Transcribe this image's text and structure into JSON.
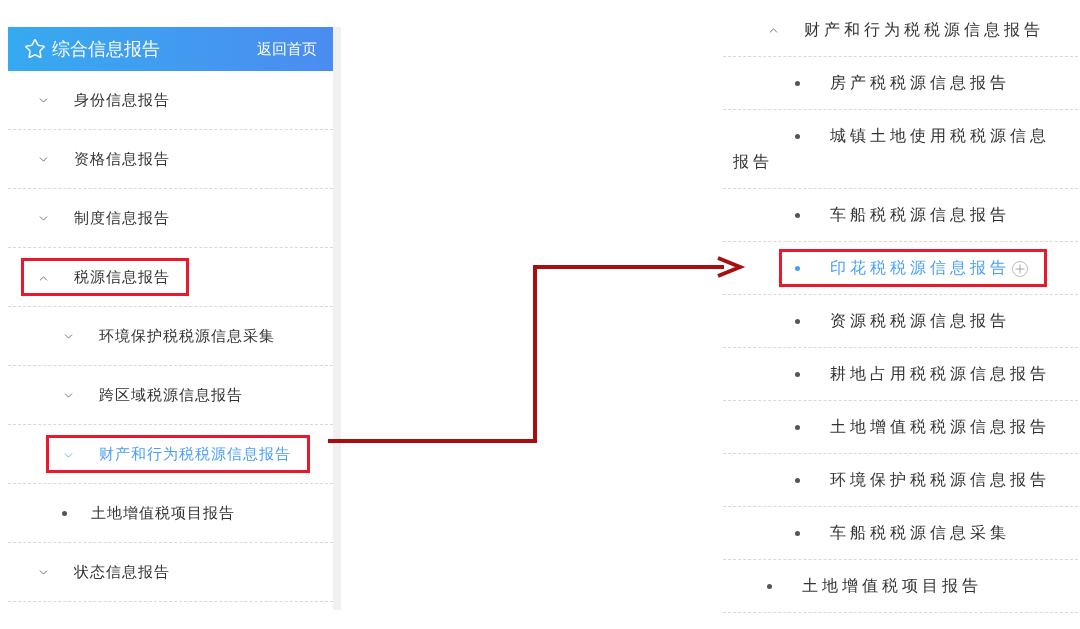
{
  "left_panel": {
    "header": {
      "title": "综合信息报告",
      "home_link": "返回首页"
    },
    "items": [
      {
        "label": "身份信息报告",
        "kind": "group",
        "expanded": false,
        "selected": false,
        "highlighted": false
      },
      {
        "label": "资格信息报告",
        "kind": "group",
        "expanded": false,
        "selected": false,
        "highlighted": false
      },
      {
        "label": "制度信息报告",
        "kind": "group",
        "expanded": false,
        "selected": false,
        "highlighted": false
      },
      {
        "label": "税源信息报告",
        "kind": "group",
        "expanded": true,
        "selected": false,
        "highlighted": true,
        "children": [
          {
            "label": "环境保护税税源信息采集",
            "kind": "group",
            "expanded": false,
            "selected": false,
            "highlighted": false
          },
          {
            "label": "跨区域税源信息报告",
            "kind": "group",
            "expanded": false,
            "selected": false,
            "highlighted": false
          },
          {
            "label": "财产和行为税税源信息报告",
            "kind": "group",
            "expanded": false,
            "selected": true,
            "highlighted": true
          },
          {
            "label": "土地增值税项目报告",
            "kind": "leaf",
            "selected": false,
            "highlighted": false
          }
        ]
      },
      {
        "label": "状态信息报告",
        "kind": "group",
        "expanded": false,
        "selected": false,
        "highlighted": false
      }
    ]
  },
  "right_panel": {
    "items": [
      {
        "label": "财产和行为税税源信息报告",
        "kind": "group",
        "expanded": true,
        "selected": false,
        "highlighted": false,
        "children": [
          {
            "label": "房产税税源信息报告",
            "kind": "leaf",
            "selected": false,
            "highlighted": false
          },
          {
            "label": "城镇土地使用税税源信息报告",
            "kind": "leaf",
            "selected": false,
            "highlighted": false
          },
          {
            "label": "车船税税源信息报告",
            "kind": "leaf",
            "selected": false,
            "highlighted": false
          },
          {
            "label": "印花税税源信息报告",
            "kind": "leaf",
            "selected": true,
            "highlighted": true
          },
          {
            "label": "资源税税源信息报告",
            "kind": "leaf",
            "selected": false,
            "highlighted": false
          },
          {
            "label": "耕地占用税税源信息报告",
            "kind": "leaf",
            "selected": false,
            "highlighted": false
          },
          {
            "label": "土地增值税税源信息报告",
            "kind": "leaf",
            "selected": false,
            "highlighted": false
          },
          {
            "label": "环境保护税税源信息报告",
            "kind": "leaf",
            "selected": false,
            "highlighted": false
          },
          {
            "label": "车船税税源信息采集",
            "kind": "leaf",
            "selected": false,
            "highlighted": false
          }
        ]
      },
      {
        "label": "土地增值税项目报告",
        "kind": "leaf",
        "selected": false,
        "highlighted": false
      }
    ]
  }
}
